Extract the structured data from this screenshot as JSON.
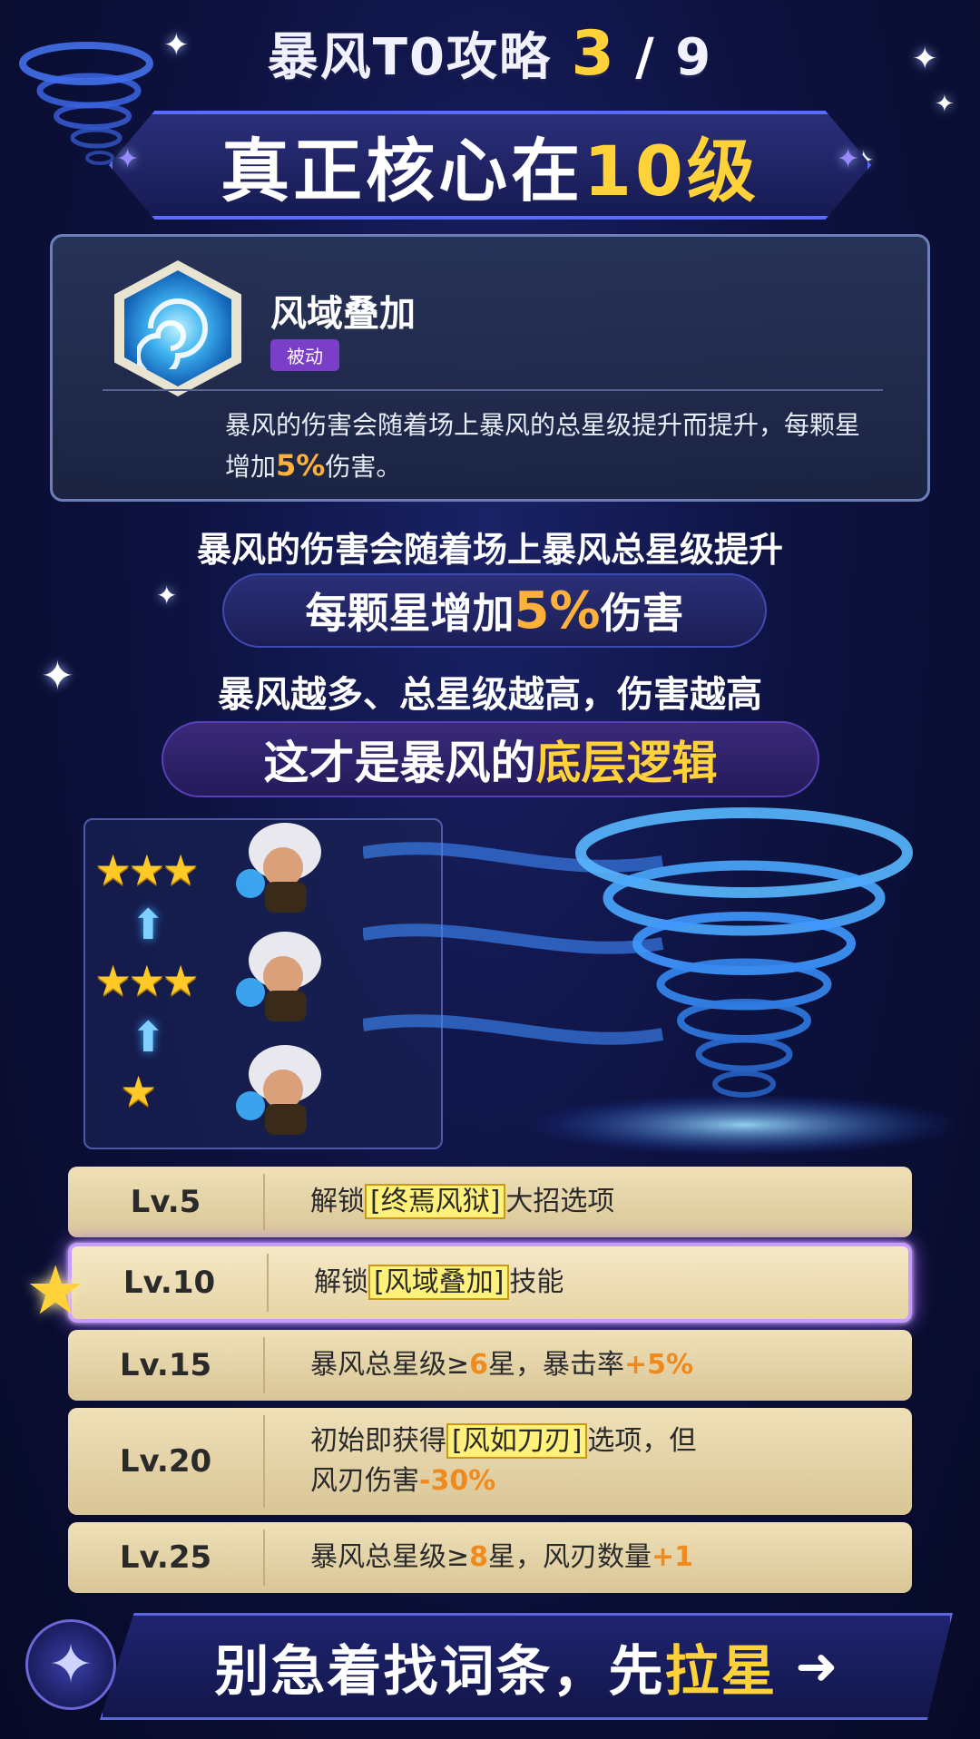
{
  "header": {
    "series_title": "暴风T0攻略",
    "page_current": "3",
    "page_sep": "/",
    "page_total": "9",
    "title_main": "真正核心在",
    "title_highlight": "10级"
  },
  "skill_card": {
    "name": "风域叠加",
    "tag": "被动",
    "desc_part1": "暴风的伤害会随着场上暴风的总星级提升而提升，每颗星增加",
    "desc_pct": "5%",
    "desc_part2": "伤害。"
  },
  "explain": {
    "line1": "暴风的伤害会随着场上暴风总星级提升",
    "pill1_pre": "每颗星增加",
    "pill1_pct": "5%",
    "pill1_post": "伤害",
    "line2": "暴风越多、总星级越高，伤害越高",
    "pill2_pre": "这才是暴风的",
    "pill2_highlight": "底层逻辑"
  },
  "illustration": {
    "rows": [
      {
        "stars": "★★★"
      },
      {
        "stars": "★★★"
      },
      {
        "stars": "★"
      }
    ],
    "arrow": "⬆"
  },
  "levels": [
    {
      "label": "Lv.5",
      "pre": "解锁",
      "kw": "[终焉风狱]",
      "post": "大招选项"
    },
    {
      "label": "Lv.10",
      "pre": "解锁",
      "kw": "[风域叠加]",
      "post": "技能"
    },
    {
      "label": "Lv.15",
      "a": "暴风总星级≥",
      "b": "6",
      "c": "星，暴击率",
      "d": "+5%"
    },
    {
      "label": "Lv.20",
      "pre": "初始即获得",
      "kw": "[风如刀刃]",
      "post": "选项，但",
      "line2a": "风刃伤害",
      "line2b": "-30%"
    },
    {
      "label": "Lv.25",
      "a": "暴风总星级≥",
      "b": "8",
      "c": "星，风刃数量",
      "d": "+1"
    }
  ],
  "footer": {
    "text_pre": "别急着找词条，先",
    "text_highlight": "拉星",
    "arrow": "➜"
  },
  "colors": {
    "accent_gold": "#ffd23a",
    "accent_orange": "#ffb13b",
    "passive_tag": "#7a3ec8",
    "active_glow": "#a56bff"
  },
  "icons": [
    "sparkle-icon",
    "tornado-icon",
    "skill-vortex-icon",
    "star-icon",
    "up-arrow-icon",
    "compass-star-icon",
    "right-arrow-icon"
  ]
}
